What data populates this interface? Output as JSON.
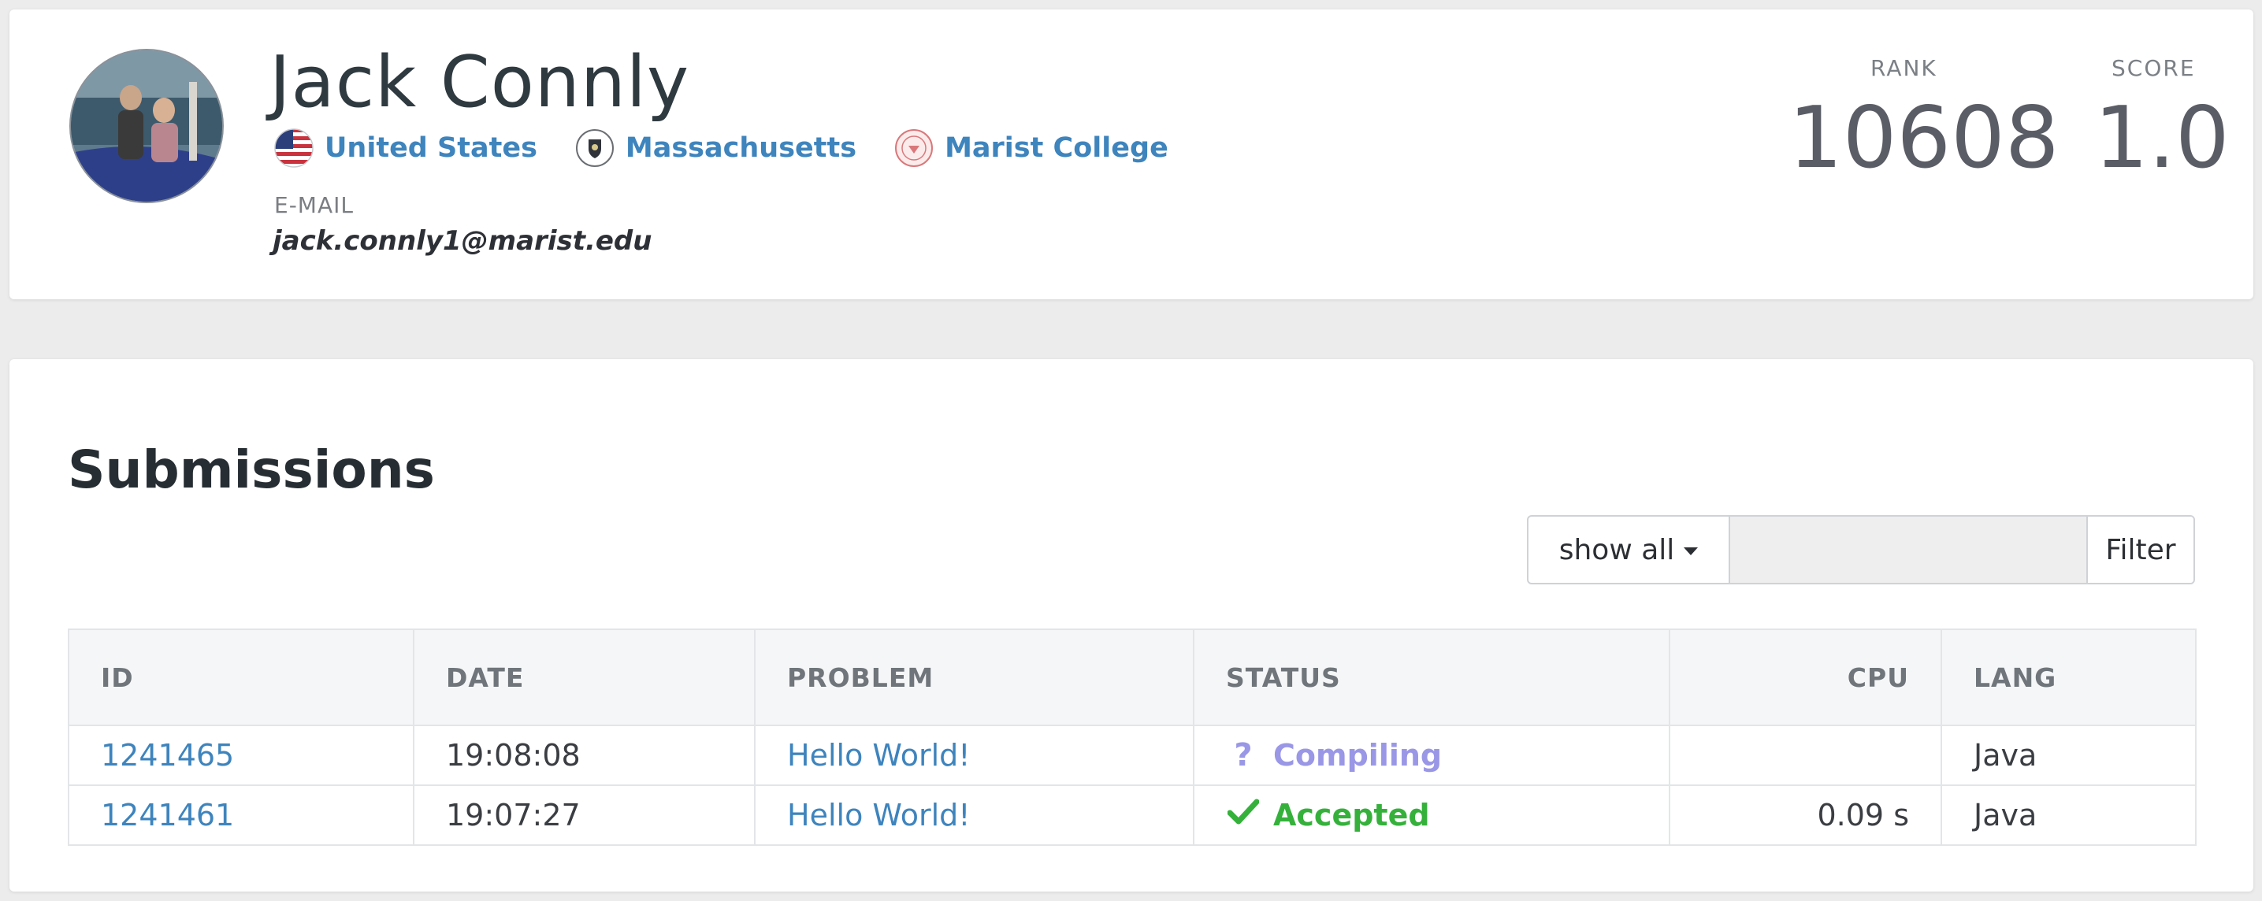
{
  "profile": {
    "name": "Jack Connly",
    "country": "United States",
    "region": "Massachusetts",
    "school": "Marist College",
    "email_label": "E-MAIL",
    "email": "jack.connly1@marist.edu",
    "rank_label": "RANK",
    "rank": "10608",
    "score_label": "SCORE",
    "score": "1.0"
  },
  "submissions": {
    "title": "Submissions",
    "filter": {
      "dropdown_label": "show all",
      "input_value": "",
      "button_label": "Filter"
    },
    "columns": [
      "ID",
      "DATE",
      "PROBLEM",
      "STATUS",
      "CPU",
      "LANG"
    ],
    "rows": [
      {
        "id": "1241465",
        "date": "19:08:08",
        "problem": "Hello World!",
        "status": "Compiling",
        "status_icon": "question-icon",
        "cpu": "",
        "lang": "Java"
      },
      {
        "id": "1241461",
        "date": "19:07:27",
        "problem": "Hello World!",
        "status": "Accepted",
        "status_icon": "check-icon",
        "cpu": "0.09 s",
        "lang": "Java"
      }
    ]
  },
  "colors": {
    "link": "#3e84bd",
    "compiling": "#9a97e6",
    "accepted": "#35b13b",
    "stat_value": "#5b5d66"
  }
}
